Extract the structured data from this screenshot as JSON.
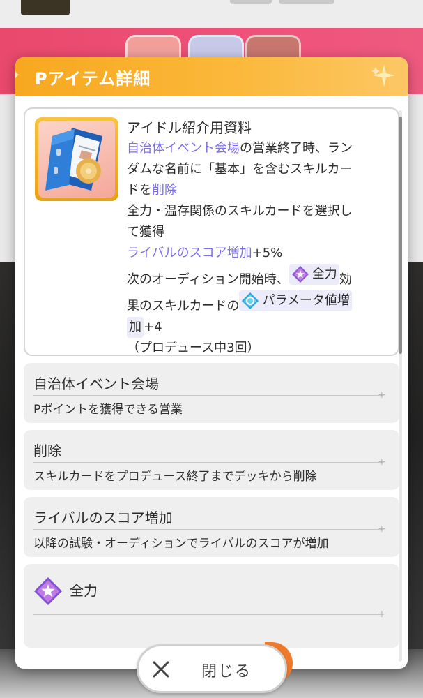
{
  "modal": {
    "title": "Pアイテム詳細"
  },
  "item": {
    "icon": "blue-folder-with-disc-icon",
    "name": "アイドル紹介用資料",
    "lines": {
      "l1_hl": "自治体イベント会場",
      "l1_rest": "の営業終了時、ラン",
      "l2": "ダムな名前に「基本」を含むスキルカー",
      "l3_pre": "ドを",
      "l3_hl": "削除",
      "l4": "全力・温存関係のスキルカードを選択し",
      "l5": "て獲得",
      "l6_hl": "ライバルのスコア増加",
      "l6_rest": "+5%",
      "l7_pre": "次のオーディション開始時、",
      "l7_chip": "全力",
      "l7_rest": "効",
      "l8_pre": "果のスキルカードの",
      "l8_chip": "パラメータ値増",
      "l9_chip": "加",
      "l9_rest": "+4",
      "l10": "（プロデュース中3回）"
    }
  },
  "keywords": [
    {
      "title": "自治体イベント会場",
      "desc": "Pポイントを獲得できる営業"
    },
    {
      "title": "削除",
      "desc": "スキルカードをプロデュース終了までデッキから削除"
    },
    {
      "title": "ライバルのスコア増加",
      "desc": "以降の試験・オーディションでライバルのスコアが増加"
    },
    {
      "title": "全力",
      "icon": "full-power-star-icon"
    }
  ],
  "close_button": {
    "label": "閉じる",
    "icon": "close-x-icon"
  },
  "colors": {
    "header": "#f7a81f",
    "highlight": "#7b6ff0",
    "keyword_bg": "#efefef",
    "background_pink": "#ee5078"
  }
}
